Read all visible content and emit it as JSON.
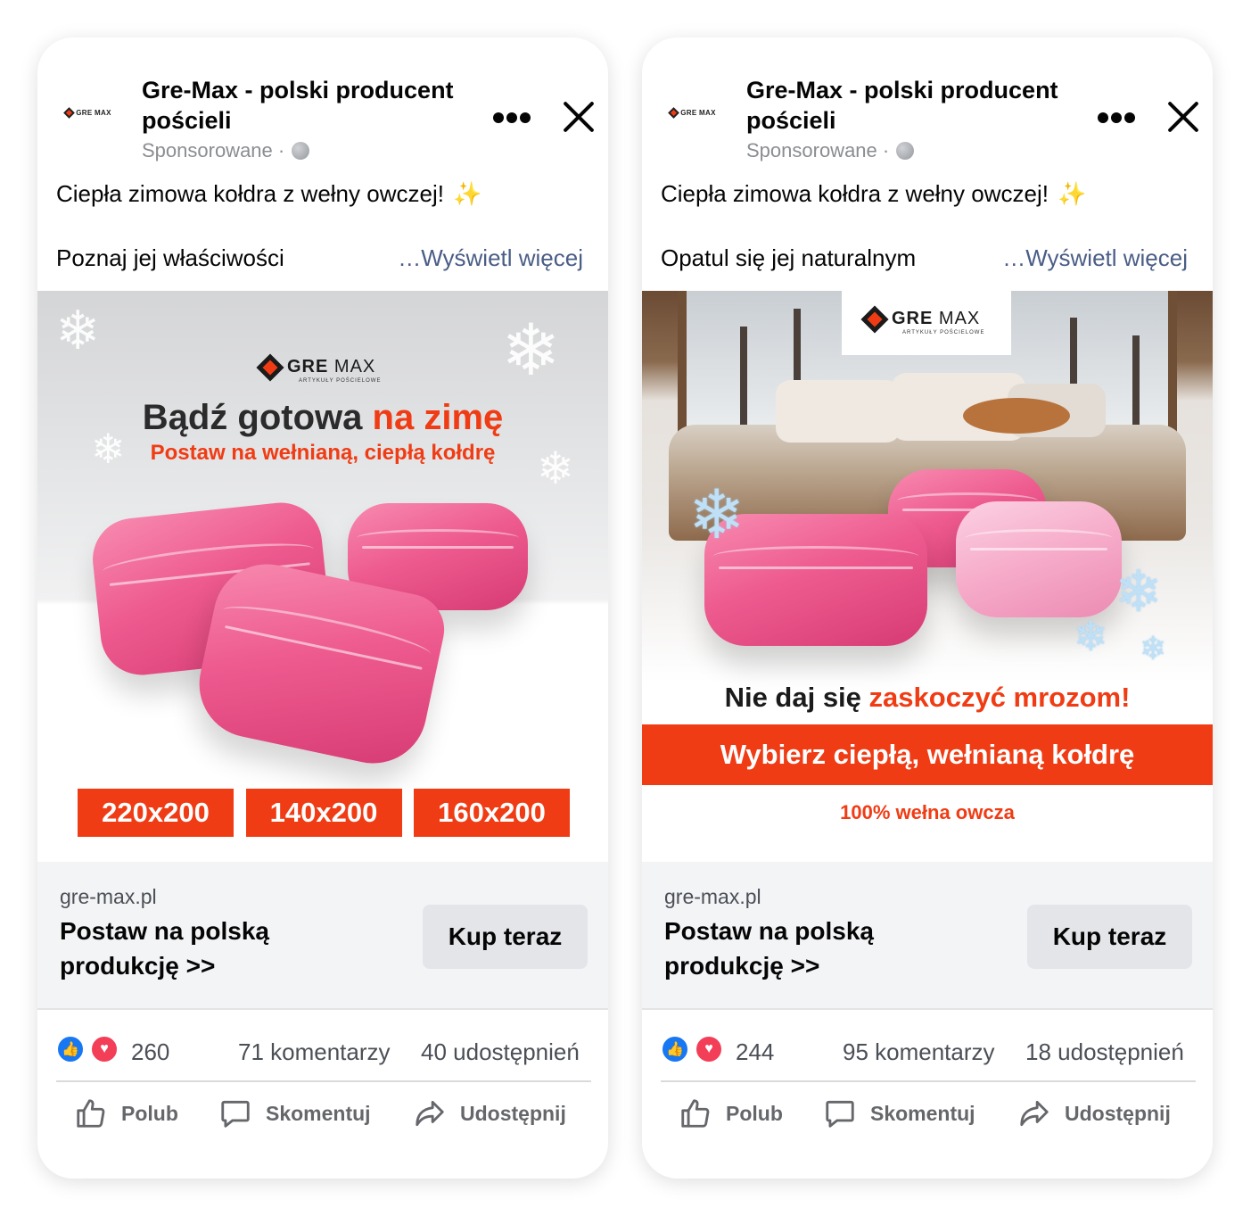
{
  "colors": {
    "accent": "#f03c14",
    "fb_blue": "#1877f2",
    "love_red": "#f33e58",
    "link": "#4a5d86"
  },
  "ads": [
    {
      "page_name": "Gre-Max - polski producent pościeli",
      "sponsored": "Sponsorowane · ",
      "body_line1": "Ciepła zimowa kołdra z wełny owczej!",
      "sparkle_icon": "✨",
      "body_line2": "Poznaj jej właściwości",
      "see_more": "…Wyświetl więcej",
      "creative": {
        "brand_gre": "GRE",
        "brand_max": "MAX",
        "brand_sub": "ARTYKUŁY POŚCIELOWE",
        "headline_dark": "Bądź gotowa",
        "headline_red": "na zimę",
        "subheadline": "Postaw na wełnianą, ciepłą kołdrę",
        "sizes": [
          "220x200",
          "140x200",
          "160x200"
        ]
      },
      "link_domain": "gre-max.pl",
      "link_title": "Postaw na polską produkcję >>",
      "cta_label": "Kup teraz",
      "reactions_count": "260",
      "comments": "71 komentarzy",
      "shares": "40 udostępnień",
      "actions": {
        "like": "Polub",
        "comment": "Skomentuj",
        "share": "Udostępnij"
      }
    },
    {
      "page_name": "Gre-Max - polski producent pościeli",
      "sponsored": "Sponsorowane · ",
      "body_line1": "Ciepła zimowa kołdra z wełny owczej!",
      "sparkle_icon": "✨",
      "body_line2": "Opatul się jej naturalnym",
      "see_more": "…Wyświetl więcej",
      "creative": {
        "brand_gre": "GRE",
        "brand_max": "MAX",
        "brand_sub": "ARTYKUŁY POŚCIELOWE",
        "slogan_dark": "Nie daj się",
        "slogan_red": "zaskoczyć mrozom!",
        "bar_text": "Wybierz ciepłą, wełnianą kołdrę",
        "wool_text": "100% wełna owcza"
      },
      "link_domain": "gre-max.pl",
      "link_title": "Postaw na polską produkcję >>",
      "cta_label": "Kup teraz",
      "reactions_count": "244",
      "comments": "95 komentarzy",
      "shares": "18 udostępnień",
      "actions": {
        "like": "Polub",
        "comment": "Skomentuj",
        "share": "Udostępnij"
      }
    }
  ]
}
